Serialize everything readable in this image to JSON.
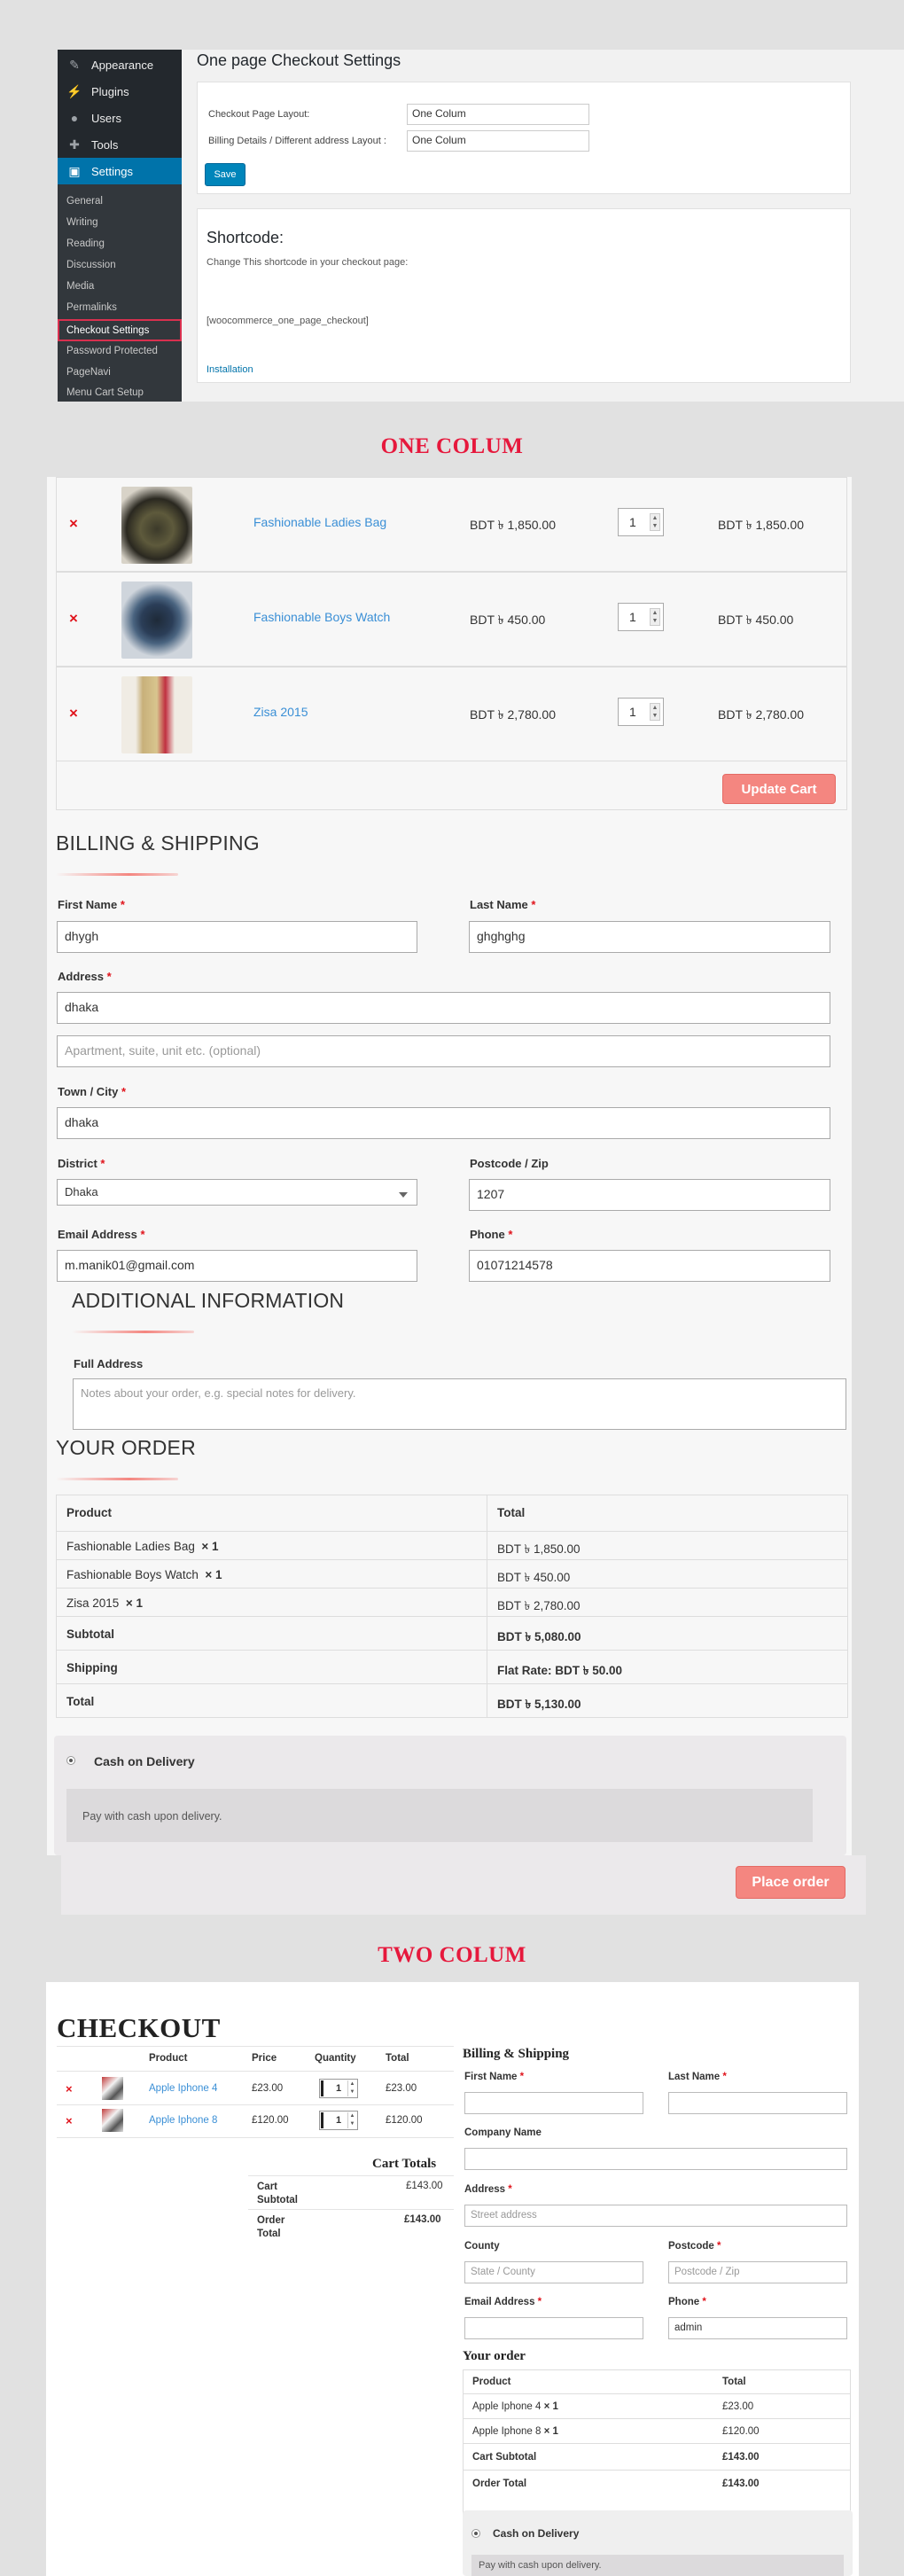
{
  "admin": {
    "sidebar_menu": [
      {
        "label": "Appearance",
        "icon": "paintbrush-icon"
      },
      {
        "label": "Plugins",
        "icon": "plugin-icon"
      },
      {
        "label": "Users",
        "icon": "users-icon"
      },
      {
        "label": "Tools",
        "icon": "wrench-icon"
      },
      {
        "label": "Settings",
        "icon": "settings-icon",
        "active": true
      }
    ],
    "submenu": [
      "General",
      "Writing",
      "Reading",
      "Discussion",
      "Media",
      "Permalinks",
      "Checkout Settings",
      "Password Protected",
      "PageNavi",
      "Menu Cart Setup"
    ],
    "title": "One page Checkout Settings",
    "layout_label": "Checkout Page Layout:",
    "layout_value": "One Colum",
    "billing_label": "Billing Details / Different address Layout :",
    "billing_value": "One Colum",
    "save_label": "Save",
    "shortcode_title": "Shortcode:",
    "shortcode_desc": "Change This shortcode in your checkout page:",
    "shortcode_value": "[woocommerce_one_page_checkout]",
    "installation_link": "Installation"
  },
  "one_colum_header": "ONE COLUM",
  "one_col": {
    "cart": [
      {
        "name": "Fashionable Ladies Bag",
        "price": "BDT ৳ 1,850.00",
        "qty": "1",
        "subtotal": "BDT ৳ 1,850.00"
      },
      {
        "name": "Fashionable Boys Watch",
        "price": "BDT ৳ 450.00",
        "qty": "1",
        "subtotal": "BDT ৳ 450.00"
      },
      {
        "name": "Zisa 2015",
        "price": "BDT ৳ 2,780.00",
        "qty": "1",
        "subtotal": "BDT ৳ 2,780.00"
      }
    ],
    "update_cart": "Update Cart",
    "billing_title": "BILLING & SHIPPING",
    "first_name_label": "First Name",
    "first_name_value": "dhygh",
    "last_name_label": "Last Name",
    "last_name_value": "ghghghg",
    "address_label": "Address",
    "address_value": "dhaka",
    "address2_placeholder": "Apartment, suite, unit etc. (optional)",
    "town_label": "Town / City",
    "town_value": "dhaka",
    "district_label": "District",
    "district_value": "Dhaka",
    "postcode_label": "Postcode / Zip",
    "postcode_value": "1207",
    "email_label": "Email Address",
    "email_value": "m.manik01@gmail.com",
    "phone_label": "Phone",
    "phone_value": "01071214578",
    "additional_title": "ADDITIONAL INFORMATION",
    "full_address_label": "Full Address",
    "notes_placeholder": "Notes about your order, e.g. special notes for delivery.",
    "order_title": "YOUR ORDER",
    "order_head_product": "Product",
    "order_head_total": "Total",
    "order_items": [
      {
        "name": "Fashionable Ladies Bag",
        "qty": "× 1",
        "total": "BDT ৳ 1,850.00"
      },
      {
        "name": "Fashionable Boys Watch",
        "qty": "× 1",
        "total": "BDT ৳ 450.00"
      },
      {
        "name": "Zisa 2015",
        "qty": "× 1",
        "total": "BDT ৳ 2,780.00"
      }
    ],
    "subtotal_label": "Subtotal",
    "subtotal_value": "BDT ৳ 5,080.00",
    "shipping_label": "Shipping",
    "shipping_value": "Flat Rate: BDT ৳ 50.00",
    "total_label": "Total",
    "total_value": "BDT ৳ 5,130.00",
    "payment_method": "Cash on Delivery",
    "payment_desc": "Pay with cash upon delivery.",
    "place_order": "Place order"
  },
  "two_colum_header": "TWO COLUM",
  "two_col": {
    "title": "CHECKOUT",
    "head_product": "Product",
    "head_price": "Price",
    "head_quantity": "Quantity",
    "head_total": "Total",
    "cart": [
      {
        "name": "Apple Iphone 4",
        "price": "£23.00",
        "qty": "1",
        "total": "£23.00"
      },
      {
        "name": "Apple Iphone 8",
        "price": "£120.00",
        "qty": "1",
        "total": "£120.00"
      }
    ],
    "cart_totals_title": "Cart Totals",
    "cart_subtotal_label": "Cart Subtotal",
    "cart_subtotal_value": "£143.00",
    "order_total_label": "Order Total",
    "order_total_value": "£143.00",
    "billing_title": "Billing & Shipping",
    "first_name_label": "First Name",
    "last_name_label": "Last Name",
    "company_label": "Company Name",
    "address_label": "Address",
    "address_placeholder": "Street address",
    "county_label": "County",
    "county_placeholder": "State / County",
    "postcode_label": "Postcode",
    "postcode_placeholder": "Postcode / Zip",
    "email_label": "Email Address",
    "phone_label": "Phone",
    "phone_value": "admin",
    "your_order_title": "Your order",
    "order_head_product": "Product",
    "order_head_total": "Total",
    "order_items": [
      {
        "name": "Apple Iphone 4",
        "qty": "× 1",
        "total": "£23.00"
      },
      {
        "name": "Apple Iphone 8",
        "qty": "× 1",
        "total": "£120.00"
      }
    ],
    "order_cart_subtotal_label": "Cart Subtotal",
    "order_cart_subtotal_value": "£143.00",
    "order_total_label2": "Order Total",
    "order_total_value2": "£143.00",
    "payment_method": "Cash on Delivery",
    "payment_desc": "Pay with cash upon delivery."
  },
  "colors": {
    "accent": "#f48680",
    "header_red": "#e6183c",
    "wp_blue": "#0073aa",
    "link_blue": "#3a8fd6"
  }
}
